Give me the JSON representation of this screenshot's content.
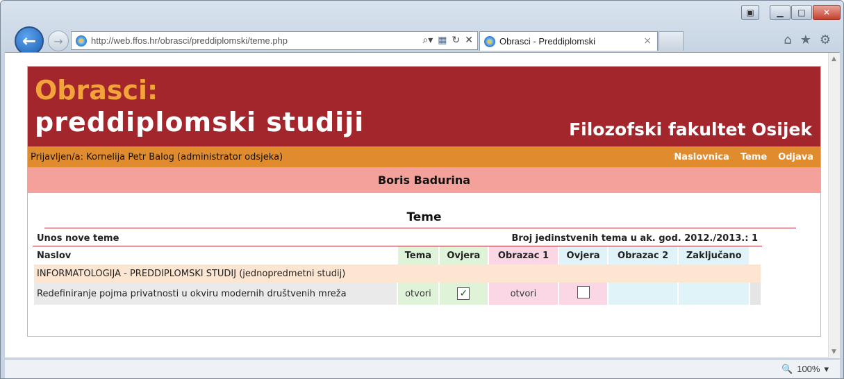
{
  "browser": {
    "url": "http://web.ffos.hr/obrasci/preddiplomski/teme.php",
    "tab_title": "Obrasci - Preddiplomski",
    "tab_close": "×",
    "zoom": "100%",
    "back_glyph": "←",
    "forward_glyph": "→",
    "icons": [
      "back-icon",
      "forward-icon",
      "search-icon",
      "refresh-icon",
      "stop-icon",
      "home-icon",
      "favorites-icon",
      "tools-icon"
    ]
  },
  "header": {
    "title_line1": "Obrasci:",
    "title_line2": "preddiplomski studiji",
    "faculty": "Filozofski fakultet Osijek"
  },
  "userbar": {
    "logged_in": "Prijavljen/a: Kornelija Petr Balog (administrator odsjeka)",
    "links": [
      "Naslovnica",
      "Teme",
      "Odjava"
    ]
  },
  "student_name": "Boris Badurina",
  "section": {
    "title": "Teme",
    "new_topic": "Unos nove teme",
    "count_label": "Broj jedinstvenih tema u ak. god. 2012./2013.: 1"
  },
  "table": {
    "columns": [
      "Naslov",
      "Tema",
      "Ovjera",
      "Obrazac 1",
      "Ovjera",
      "Obrazac 2",
      "Zaključano"
    ],
    "group": "INFORMATOLOGIJA - PREDDIPLOMSKI STUDIJ (jednopredmetni studij)",
    "rows": [
      {
        "naslov": "Redefiniranje pojma privatnosti u okviru modernih društvenih mreža",
        "tema": "otvori",
        "ovjera1_checked": true,
        "obrazac1": "otvori",
        "ovjera2_checked": false
      }
    ]
  },
  "colors": {
    "header_bg": "#a3262c",
    "title_accent": "#f2a33a",
    "userbar_bg": "#e08b2e",
    "namebar_bg": "#f4a19c"
  }
}
